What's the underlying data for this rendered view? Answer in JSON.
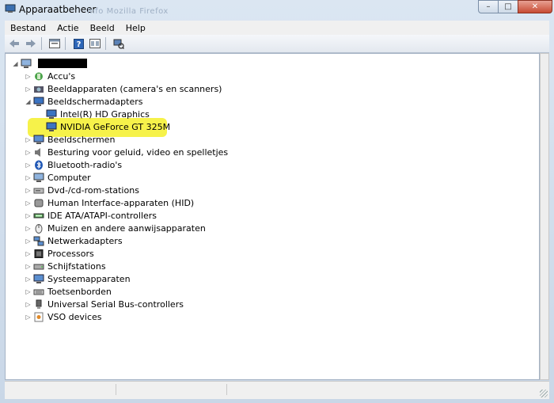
{
  "window": {
    "title": "Apparaatbeheer",
    "background_title_ghost": "Info  Mozilla Firefox",
    "buttons": {
      "minimize": "–",
      "maximize": "□",
      "close": "✕"
    }
  },
  "menu": {
    "items": [
      "Bestand",
      "Actie",
      "Beeld",
      "Help"
    ]
  },
  "toolbar": {
    "buttons": [
      "back-icon",
      "forward-icon",
      "properties-icon",
      "help-icon",
      "view-icon",
      "scan-icon"
    ]
  },
  "tree": {
    "root_label": "",
    "items": [
      "Accu's",
      "Beeldapparaten (camera's en scanners)",
      "Beeldschermadapters",
      "Intel(R) HD Graphics",
      "NVIDIA GeForce GT 325M",
      "Beeldschermen",
      "Besturing voor geluid, video en spelletjes",
      "Bluetooth-radio's",
      "Computer",
      "Dvd-/cd-rom-stations",
      "Human Interface-apparaten (HID)",
      "IDE ATA/ATAPI-controllers",
      "Muizen en andere aanwijsapparaten",
      "Netwerkadapters",
      "Processors",
      "Schijfstations",
      "Systeemapparaten",
      "Toetsenborden",
      "Universal Serial Bus-controllers",
      "VSO devices"
    ]
  },
  "colors": {
    "highlight": "#f6f24a",
    "close_button": "#c74b33",
    "frame": "#cfdbe8"
  }
}
